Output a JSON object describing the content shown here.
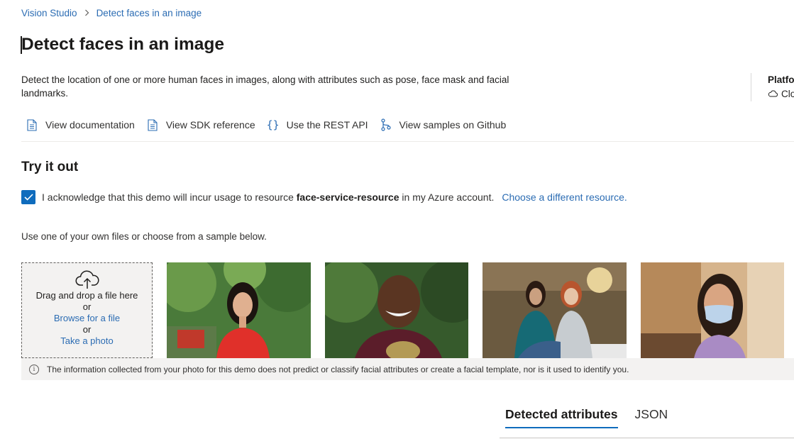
{
  "breadcrumb": {
    "root": "Vision Studio",
    "separator": ">",
    "current": "Detect faces in an image"
  },
  "page": {
    "title": "Detect faces in an image",
    "description": "Detect the location of one or more human faces in images, along with attributes such as pose, face mask and facial landmarks."
  },
  "platform": {
    "title": "Platfo",
    "value": "Clo"
  },
  "links": {
    "documentation": "View documentation",
    "sdk": "View SDK reference",
    "rest": "Use the REST API",
    "github": "View samples on Github"
  },
  "try_it": {
    "title": "Try it out",
    "ack_checked": true,
    "ack_prefix": "I acknowledge that this demo will incur usage to resource",
    "resource_name": "face-service-resource",
    "ack_suffix": "in my Azure account.",
    "choose_resource": "Choose a different resource.",
    "use_text": "Use one of your own files or choose from a sample below."
  },
  "upload": {
    "drag_text": "Drag and drop a file here",
    "or1": "or",
    "browse": "Browse for a file",
    "or2": "or",
    "take_photo": "Take a photo"
  },
  "samples": [
    {
      "name": "sample-woman-red-dress"
    },
    {
      "name": "sample-man-smiling"
    },
    {
      "name": "sample-two-women-office"
    },
    {
      "name": "sample-woman-face-mask"
    }
  ],
  "notice": {
    "text": "The information collected from your photo for this demo does not predict or classify facial attributes or create a facial template, nor is it used to identify you."
  },
  "tabs": {
    "detected": "Detected attributes",
    "json": "JSON"
  },
  "colors": {
    "link": "#2b6cb3",
    "accent": "#0f6cbd"
  }
}
